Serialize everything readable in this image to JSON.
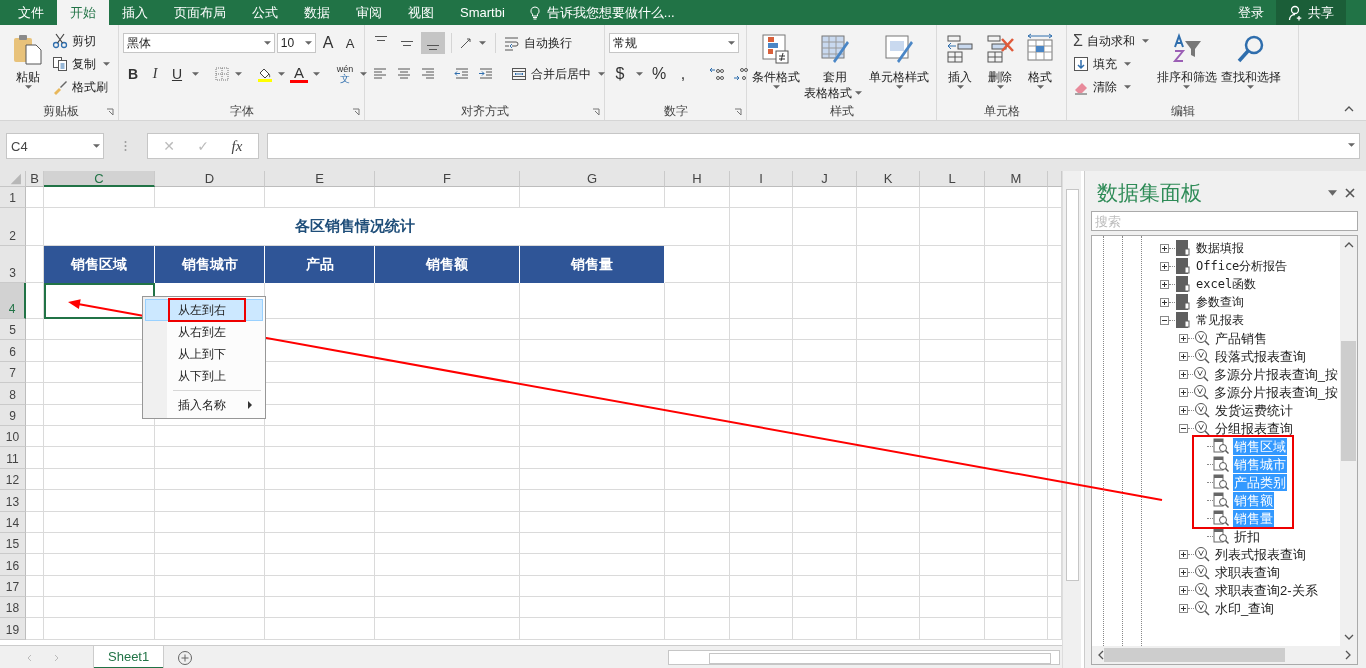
{
  "tabs": [
    {
      "label": "文件",
      "selected": false
    },
    {
      "label": "开始",
      "selected": true
    },
    {
      "label": "插入",
      "selected": false
    },
    {
      "label": "页面布局",
      "selected": false
    },
    {
      "label": "公式",
      "selected": false
    },
    {
      "label": "数据",
      "selected": false
    },
    {
      "label": "审阅",
      "selected": false
    },
    {
      "label": "视图",
      "selected": false
    },
    {
      "label": "Smartbi",
      "selected": false
    }
  ],
  "tell_me": "告诉我您想要做什么...",
  "account": {
    "sign_in": "登录",
    "share": "共享"
  },
  "ribbon": {
    "clipboard": {
      "label": "剪贴板",
      "paste": "粘贴",
      "cut": "剪切",
      "copy": "复制",
      "format_painter": "格式刷"
    },
    "font": {
      "label": "字体",
      "font_name": "黑体",
      "font_size": "10",
      "grow": "A",
      "shrink": "A",
      "bold": "B",
      "italic": "I",
      "underline": "U",
      "font_color": "A",
      "phonetic_top": "wén",
      "phonetic_bottom": "文"
    },
    "alignment": {
      "label": "对齐方式",
      "vertical": [
        {
          "selected": false
        },
        {
          "selected": false
        },
        {
          "selected": true
        }
      ],
      "wrap": "自动换行",
      "merge": "合并后居中"
    },
    "number": {
      "label": "数字",
      "format": "常规",
      "currency": "$",
      "percent": "%",
      "comma": ","
    },
    "styles": {
      "label": "样式",
      "conditional": "条件格式",
      "table_top": "套用",
      "table_bottom": "表格格式",
      "cell_styles": "单元格样式"
    },
    "cells": {
      "label": "单元格",
      "insert": "插入",
      "delete": "删除",
      "format": "格式"
    },
    "editing": {
      "label": "编辑",
      "sigma": "Σ",
      "autosum": "自动求和",
      "fill": "填充",
      "clear": "清除",
      "sort": "排序和筛选",
      "find": "查找和选择"
    }
  },
  "formula_bar": {
    "name_box": "C4",
    "cancel": "✕",
    "enter": "✓",
    "function": "fx"
  },
  "sheet": {
    "columns": [
      {
        "label": "B",
        "selected": false
      },
      {
        "label": "C",
        "selected": true
      },
      {
        "label": "D",
        "selected": false
      },
      {
        "label": "E",
        "selected": false
      },
      {
        "label": "F",
        "selected": false
      },
      {
        "label": "G",
        "selected": false
      },
      {
        "label": "H",
        "selected": false
      },
      {
        "label": "I",
        "selected": false
      },
      {
        "label": "J",
        "selected": false
      },
      {
        "label": "K",
        "selected": false
      },
      {
        "label": "L",
        "selected": false
      },
      {
        "label": "M",
        "selected": false
      }
    ],
    "rows": [
      {
        "label": "1",
        "selected": false
      },
      {
        "label": "2",
        "selected": false
      },
      {
        "label": "3",
        "selected": false
      },
      {
        "label": "4",
        "selected": true
      },
      {
        "label": "5",
        "selected": false
      },
      {
        "label": "6",
        "selected": false
      },
      {
        "label": "7",
        "selected": false
      },
      {
        "label": "8",
        "selected": false
      },
      {
        "label": "9",
        "selected": false
      },
      {
        "label": "10",
        "selected": false
      },
      {
        "label": "11",
        "selected": false
      },
      {
        "label": "12",
        "selected": false
      },
      {
        "label": "13",
        "selected": false
      },
      {
        "label": "14",
        "selected": false
      },
      {
        "label": "15",
        "selected": false
      },
      {
        "label": "16",
        "selected": false
      },
      {
        "label": "17",
        "selected": false
      },
      {
        "label": "18",
        "selected": false
      },
      {
        "label": "19",
        "selected": false
      }
    ],
    "title": "各区销售情况统计",
    "header_row": [
      "销售区域",
      "销售城市",
      "产品",
      "销售额",
      "销售量"
    ]
  },
  "context_menu": [
    {
      "label": "从左到右",
      "kind": "item",
      "selected": true
    },
    {
      "label": "从右到左",
      "kind": "item",
      "selected": false
    },
    {
      "label": "从上到下",
      "kind": "item",
      "selected": false
    },
    {
      "label": "从下到上",
      "kind": "item",
      "selected": false
    },
    {
      "label": "插入名称",
      "kind": "submenu",
      "selected": false
    }
  ],
  "sheet_tabs": [
    {
      "label": "Sheet1",
      "selected": true
    }
  ],
  "panel": {
    "title": "数据集面板",
    "search": {
      "placeholder": "搜索"
    },
    "tree": [
      {
        "label": "数据填报",
        "kind": "folder",
        "expanded": false
      },
      {
        "label": "Office分析报告",
        "kind": "folder",
        "expanded": false
      },
      {
        "label": "excel函数",
        "kind": "folder",
        "expanded": false
      },
      {
        "label": "参数查询",
        "kind": "folder",
        "expanded": false
      },
      {
        "label": "常见报表",
        "kind": "folder",
        "expanded": true,
        "children": [
          {
            "label": "产品销售",
            "kind": "query",
            "expanded": false
          },
          {
            "label": "段落式报表查询",
            "kind": "query",
            "expanded": false
          },
          {
            "label": "多源分片报表查询_按",
            "kind": "query",
            "expanded": false
          },
          {
            "label": "多源分片报表查询_按",
            "kind": "query",
            "expanded": false
          },
          {
            "label": "发货运费统计",
            "kind": "query",
            "expanded": false
          },
          {
            "label": "分组报表查询",
            "kind": "query",
            "expanded": true,
            "children": [
              {
                "label": "销售区域",
                "kind": "field",
                "selected": true
              },
              {
                "label": "销售城市",
                "kind": "field",
                "selected": true
              },
              {
                "label": "产品类别",
                "kind": "field",
                "selected": true
              },
              {
                "label": "销售额",
                "kind": "field",
                "selected": true
              },
              {
                "label": "销售量",
                "kind": "field",
                "selected": true
              },
              {
                "label": "折扣",
                "kind": "field",
                "selected": false
              }
            ]
          },
          {
            "label": "列表式报表查询",
            "kind": "query",
            "expanded": false
          },
          {
            "label": "求职表查询",
            "kind": "query",
            "expanded": false
          },
          {
            "label": "求职表查询2-关系",
            "kind": "query",
            "expanded": false
          },
          {
            "label": "水印_查询",
            "kind": "query",
            "expanded": false
          }
        ]
      }
    ]
  }
}
